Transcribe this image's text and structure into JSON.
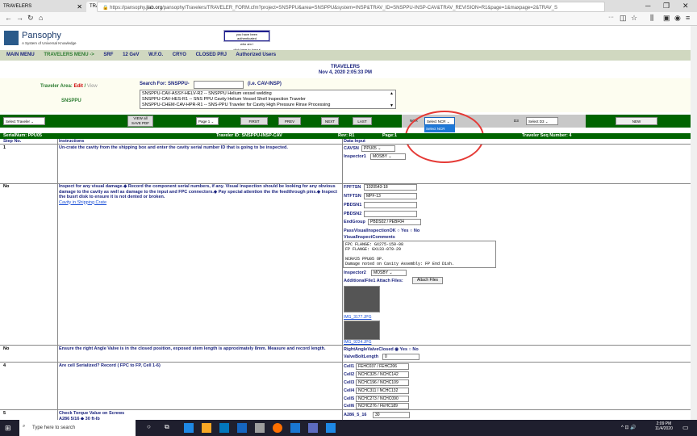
{
  "browser": {
    "tabs": [
      {
        "label": "TRAVELERS"
      },
      {
        "label": "TRAVELERS"
      }
    ],
    "url_pre": "https://pansophy.",
    "url_domain": "jlab.org",
    "url_post": "/pansophy/Travelers/TRAVELER_FORM.cfm?project=SNSPPU&area=SNSPPU&system=INSP&TRAV_ID=SNSPPU-INSP-CAV&TRAV_REVISION=R1&page=1&maxpage=2&TRAV_S",
    "url_more": "···"
  },
  "header": {
    "logo_title": "Pansophy",
    "logo_subtitle": "A System of Universal Knowledge",
    "auth_line": "you have been authenticated",
    "auth_who": "who am I",
    "auth_logout": "click here to logout"
  },
  "menu": {
    "items": [
      "MAIN MENU",
      "TRAVELERS MENU ->",
      "SRF",
      "12 GeV",
      "W.F.O.",
      "CRYO",
      "CLOSED PRJ",
      "Authorized Users"
    ]
  },
  "page": {
    "title": "TRAVELERS",
    "datetime": "Nov 4, 2020 2:05:33 PM"
  },
  "area": {
    "label": "Traveler Area:",
    "edit": "Edit",
    "sep": "/",
    "view": "View",
    "value": "SNSPPU"
  },
  "search": {
    "label": "Search For: SNSPPU-",
    "hint": "(i.e. CAV-INSP)",
    "list": [
      "SNSPPU-CAV-ASSY-HELV-R2 -- SNSPPU Helium vessel welding",
      "SNSPPU-CAV-HES-R1 -- SNS PPU Cavity Helium Vessel Shell Inspection Traveler",
      "SNSPPU-CHEM-CAV-HPR-R1 -- SNS-PPU Traveler for Cavity High Pressure Rinse Processing"
    ]
  },
  "toolbar": {
    "select_traveler": "Select Traveler",
    "view_all": "VIEW all",
    "save_pdf": "SAVE PDF",
    "page_select": "Page 1",
    "first": "FIRST",
    "prev": "PREV",
    "next": "NEXT",
    "last": "LAST",
    "ncr_label": "NCR",
    "ncr_select": "Select NCR",
    "ncr_option": "Select NCR",
    "d3_label": "D3",
    "d3_select": "Select D3",
    "new": "NEW"
  },
  "serial_bar": {
    "serial": "SerialNum: PPU05",
    "traveler_id": "Traveler ID: SNSPPU-INSP-CAV",
    "rev": "Rev: R1",
    "page": "Page:1",
    "seq": "Traveler Seq Number: 4"
  },
  "columns": {
    "step": "Step No.",
    "instructions": "Instructions",
    "data": "Data Input"
  },
  "steps": [
    {
      "no": "1",
      "instruction": "Un-crate the cavity from the shipping box and enter the cavity serial number ID that is going to be inspected.",
      "fields": [
        {
          "label": "CAVSN",
          "value": "PPU05"
        },
        {
          "label": "Inspector1",
          "value": "MOSBY"
        }
      ]
    },
    {
      "no": "No",
      "instruction": "Inspect for any visual damage.◆ Record the component serial numbers, if any. Visual inspection should be looking for any obvious damage to the cavity as well as damage to the input and FPC connectors.◆ Pay special attention the the feedthrough pins.◆ Inspect the busrt disk to ensure it is not dented or broken.",
      "link": "Cavity in Shipping Crate",
      "fields": [
        {
          "label": "FPFTSN",
          "value": "1020543-18"
        },
        {
          "label": "NTFTSN",
          "value": "MPF-13"
        },
        {
          "label": "PBDSN1",
          "value": ""
        },
        {
          "label": "PBDSN2",
          "value": ""
        },
        {
          "label": "EndGroup",
          "value": "PBDS02 / PEBF04"
        }
      ],
      "pass_label": "PassVisualInspectionOK",
      "yes": "Yes",
      "comments_label": "VisualInspectComments",
      "comments": "FPC FLANGE: GX275-150-08\nFP FLANGE: GX133-079-29\n\nNCR#25 PPU05 OP.\nDamage noted on Cavity Assembly: FP End Dish.",
      "inspector_label": "Inspector2",
      "inspector_value": "MOSBY",
      "attach_label": "AdditionalFile1 Attach Files:",
      "attach_button": "Attach Files",
      "file1": "IMG_3177.JPG",
      "file2": "IMG_9224.JPG"
    },
    {
      "no": "No",
      "instruction": "Ensure the right Angle Valve is in the closed position, exposed stem length is approximately 8mm. Measure and record length.",
      "valve_label": "RightAngleValveClosed",
      "yes": "Yes",
      "bolt_label": "ValveBoltLength",
      "bolt_value": "0"
    },
    {
      "no": "4",
      "instruction": "Are cell Serialized? Record ( FPC to FP, Cell 1-6)",
      "cells": [
        {
          "label": "Cell1",
          "value": "FEHC037 / FEHC206"
        },
        {
          "label": "Cell2",
          "value": "NCHC325 / NCHC142"
        },
        {
          "label": "Cell3",
          "value": "NCHC196 / NCHC109"
        },
        {
          "label": "Cell4",
          "value": "NCHC311 / NCHC132"
        },
        {
          "label": "Cell5",
          "value": "NCHC273 / NCHC090"
        },
        {
          "label": "Cell6",
          "value": "NCHC276 / FEHC189"
        }
      ]
    },
    {
      "no": "5",
      "instruction": "Check Torque Value on Screws",
      "sub": "A286 5/16 ◆ 30 ft-lb",
      "field_label": "A286_5_16",
      "field_value": "30"
    }
  ],
  "taskbar": {
    "search": "Type here to search",
    "time": "2:09 PM",
    "date": "11/4/2020"
  }
}
